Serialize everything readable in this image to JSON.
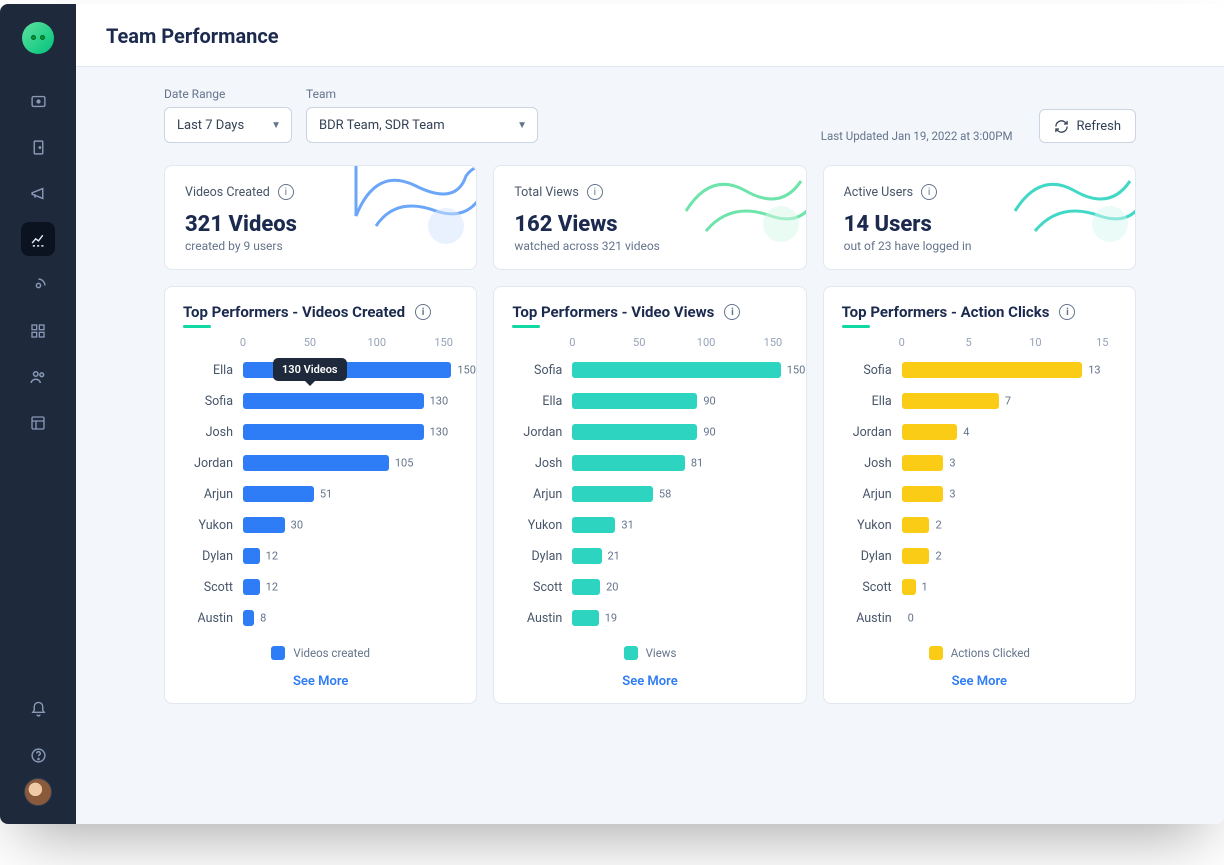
{
  "page": {
    "title": "Team Performance"
  },
  "filters": {
    "dateRange": {
      "label": "Date Range",
      "value": "Last 7 Days"
    },
    "team": {
      "label": "Team",
      "value": "BDR Team, SDR Team"
    },
    "lastUpdatedPrefix": "Last Updated ",
    "lastUpdated": "Jan 19, 2022 at 3:00PM",
    "refresh": "Refresh"
  },
  "stats": {
    "videos": {
      "label": "Videos Created",
      "big": "321 Videos",
      "sub": "created by 9 users"
    },
    "views": {
      "label": "Total Views",
      "big": "162 Views",
      "sub": "watched across 321 videos"
    },
    "users": {
      "label": "Active Users",
      "big": "14 Users",
      "sub": "out of 23 have logged in"
    }
  },
  "charts": {
    "created": {
      "title": "Top Performers - Videos Created",
      "legend": "Videos created",
      "seeMore": "See More",
      "ticks": [
        "0",
        "50",
        "100",
        "150"
      ],
      "tooltip": "130 Videos"
    },
    "views": {
      "title": "Top Performers - Video Views",
      "legend": "Views",
      "seeMore": "See More",
      "ticks": [
        "0",
        "50",
        "100",
        "150"
      ]
    },
    "actions": {
      "title": "Top Performers - Action Clicks",
      "legend": "Actions Clicked",
      "seeMore": "See More",
      "ticks": [
        "0",
        "5",
        "10",
        "15"
      ]
    }
  },
  "chart_data": [
    {
      "type": "bar",
      "title": "Top Performers - Videos Created",
      "xlabel": "",
      "ylabel": "",
      "ylim": [
        0,
        155
      ],
      "categories": [
        "Ella",
        "Sofia",
        "Josh",
        "Jordan",
        "Arjun",
        "Yukon",
        "Dylan",
        "Scott",
        "Austin"
      ],
      "values": [
        150,
        130,
        130,
        105,
        51,
        30,
        12,
        12,
        8
      ],
      "color": "#2E7CF6"
    },
    {
      "type": "bar",
      "title": "Top Performers - Video Views",
      "xlabel": "",
      "ylabel": "",
      "ylim": [
        0,
        155
      ],
      "categories": [
        "Sofia",
        "Ella",
        "Jordan",
        "Josh",
        "Arjun",
        "Yukon",
        "Dylan",
        "Scott",
        "Austin"
      ],
      "values": [
        150,
        90,
        90,
        81,
        58,
        31,
        21,
        20,
        19
      ],
      "color": "#2DD4BF"
    },
    {
      "type": "bar",
      "title": "Top Performers - Action Clicks",
      "xlabel": "",
      "ylabel": "",
      "ylim": [
        0,
        15.5
      ],
      "categories": [
        "Sofia",
        "Ella",
        "Jordan",
        "Josh",
        "Arjun",
        "Yukon",
        "Dylan",
        "Scott",
        "Austin"
      ],
      "values": [
        13,
        7,
        4,
        3,
        3,
        2,
        2,
        1,
        0
      ],
      "color": "#FACC15"
    }
  ]
}
